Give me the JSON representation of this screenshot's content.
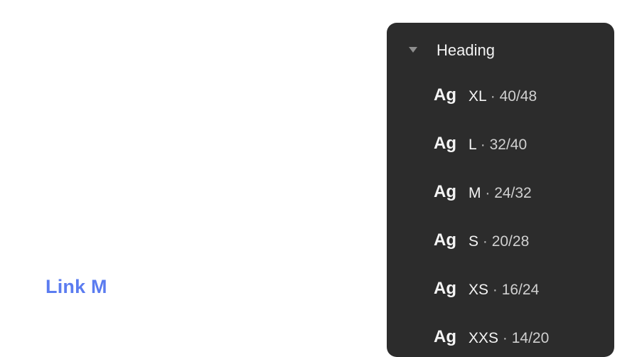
{
  "link": {
    "label": "Link M",
    "color": "#5b7cf0"
  },
  "panel": {
    "section_title": "Heading",
    "background": "#2c2c2c",
    "items": [
      {
        "preview": "Ag",
        "size": "XL",
        "separator": "·",
        "metric": "40/48"
      },
      {
        "preview": "Ag",
        "size": "L",
        "separator": "·",
        "metric": "32/40"
      },
      {
        "preview": "Ag",
        "size": "M",
        "separator": "·",
        "metric": "24/32"
      },
      {
        "preview": "Ag",
        "size": "S",
        "separator": "·",
        "metric": "20/28"
      },
      {
        "preview": "Ag",
        "size": "XS",
        "separator": "·",
        "metric": "16/24"
      },
      {
        "preview": "Ag",
        "size": "XXS",
        "separator": "·",
        "metric": "14/20"
      }
    ]
  }
}
